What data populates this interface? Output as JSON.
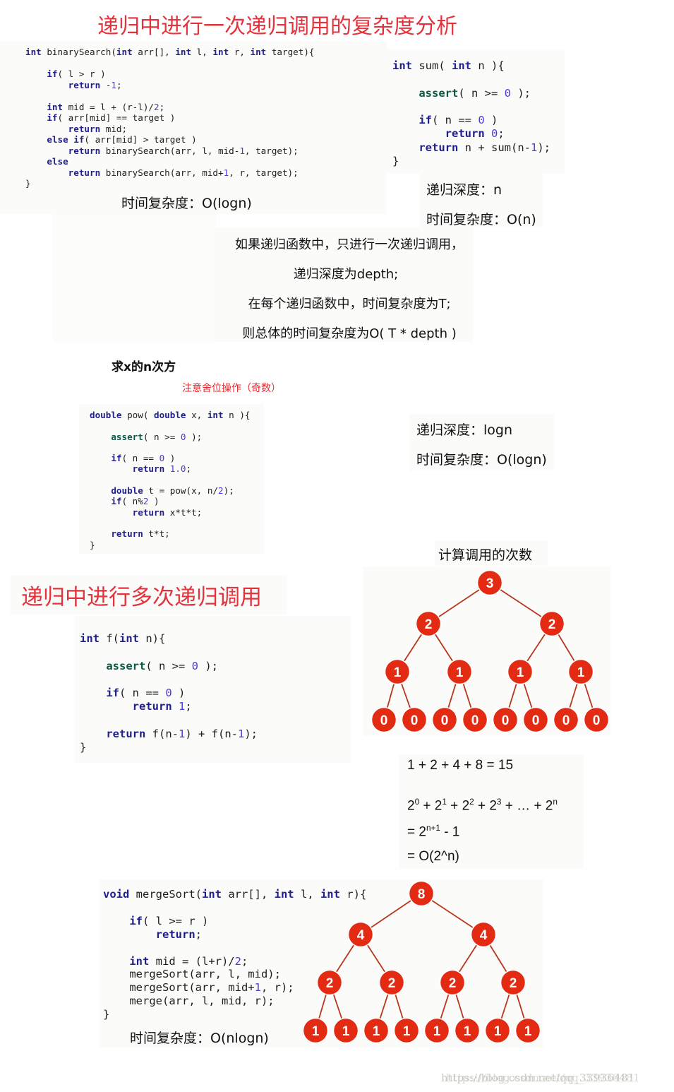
{
  "section1": {
    "title": "递归中进行一次递归调用的复杂度分析",
    "binary_search": {
      "code": [
        [
          [
            "kw",
            "int"
          ],
          [
            "p",
            " binarySearch("
          ],
          [
            "kw",
            "int"
          ],
          [
            "p",
            " arr[], "
          ],
          [
            "kw",
            "int"
          ],
          [
            "p",
            " l, "
          ],
          [
            "kw",
            "int"
          ],
          [
            "p",
            " r, "
          ],
          [
            "kw",
            "int"
          ],
          [
            "p",
            " target){"
          ]
        ],
        [],
        [
          [
            "p",
            "    "
          ],
          [
            "kw",
            "if"
          ],
          [
            "p",
            "( l > r )"
          ]
        ],
        [
          [
            "p",
            "        "
          ],
          [
            "kw",
            "return"
          ],
          [
            "p",
            " -"
          ],
          [
            "num",
            "1"
          ],
          [
            "p",
            ";"
          ]
        ],
        [],
        [
          [
            "p",
            "    "
          ],
          [
            "kw",
            "int"
          ],
          [
            "p",
            " mid = l + (r-l)/"
          ],
          [
            "num",
            "2"
          ],
          [
            "p",
            ";"
          ]
        ],
        [
          [
            "p",
            "    "
          ],
          [
            "kw",
            "if"
          ],
          [
            "p",
            "( arr[mid] == target )"
          ]
        ],
        [
          [
            "p",
            "        "
          ],
          [
            "kw",
            "return"
          ],
          [
            "p",
            " mid;"
          ]
        ],
        [
          [
            "p",
            "    "
          ],
          [
            "kw",
            "else if"
          ],
          [
            "p",
            "( arr[mid] > target )"
          ]
        ],
        [
          [
            "p",
            "        "
          ],
          [
            "kw",
            "return"
          ],
          [
            "p",
            " binarySearch(arr, l, mid-"
          ],
          [
            "num",
            "1"
          ],
          [
            "p",
            ", target);"
          ]
        ],
        [
          [
            "p",
            "    "
          ],
          [
            "kw",
            "else"
          ]
        ],
        [
          [
            "p",
            "        "
          ],
          [
            "kw",
            "return"
          ],
          [
            "p",
            " binarySearch(arr, mid+"
          ],
          [
            "num",
            "1"
          ],
          [
            "p",
            ", r, target);"
          ]
        ],
        [
          [
            "p",
            "}"
          ]
        ]
      ],
      "complexity": "时间复杂度：O(logn)"
    },
    "sum": {
      "code": [
        [
          [
            "kw",
            "int"
          ],
          [
            "p",
            " sum( "
          ],
          [
            "kw",
            "int"
          ],
          [
            "p",
            " n ){"
          ]
        ],
        [],
        [
          [
            "p",
            "    "
          ],
          [
            "as",
            "assert"
          ],
          [
            "p",
            "( n >= "
          ],
          [
            "num",
            "0"
          ],
          [
            "p",
            " );"
          ]
        ],
        [],
        [
          [
            "p",
            "    "
          ],
          [
            "kw",
            "if"
          ],
          [
            "p",
            "( n == "
          ],
          [
            "num",
            "0"
          ],
          [
            "p",
            " )"
          ]
        ],
        [
          [
            "p",
            "        "
          ],
          [
            "kw",
            "return"
          ],
          [
            "p",
            " "
          ],
          [
            "num",
            "0"
          ],
          [
            "p",
            ";"
          ]
        ],
        [
          [
            "p",
            "    "
          ],
          [
            "kw",
            "return"
          ],
          [
            "p",
            " n + sum(n-"
          ],
          [
            "num",
            "1"
          ],
          [
            "p",
            ");"
          ]
        ],
        [
          [
            "p",
            "}"
          ]
        ]
      ],
      "depth": "递归深度：n",
      "complexity": "时间复杂度：O(n)"
    },
    "summary": [
      "如果递归函数中，只进行一次递归调用，",
      "递归深度为depth;",
      "在每个递归函数中，时间复杂度为T;",
      "则总体的时间复杂度为O( T * depth )"
    ]
  },
  "pow_section": {
    "heading": "求x的n次方",
    "note": "注意舍位操作（奇数）",
    "code": [
      [
        [
          "kw",
          "double"
        ],
        [
          "p",
          " pow( "
        ],
        [
          "kw",
          "double"
        ],
        [
          "p",
          " x, "
        ],
        [
          "kw",
          "int"
        ],
        [
          "p",
          " n ){"
        ]
      ],
      [],
      [
        [
          "p",
          "    "
        ],
        [
          "as",
          "assert"
        ],
        [
          "p",
          "( n >= "
        ],
        [
          "num",
          "0"
        ],
        [
          "p",
          " );"
        ]
      ],
      [],
      [
        [
          "p",
          "    "
        ],
        [
          "kw",
          "if"
        ],
        [
          "p",
          "( n == "
        ],
        [
          "num",
          "0"
        ],
        [
          "p",
          " )"
        ]
      ],
      [
        [
          "p",
          "        "
        ],
        [
          "kw",
          "return"
        ],
        [
          "p",
          " "
        ],
        [
          "num",
          "1.0"
        ],
        [
          "p",
          ";"
        ]
      ],
      [],
      [
        [
          "p",
          "    "
        ],
        [
          "kw",
          "double"
        ],
        [
          "p",
          " t = pow(x, n/"
        ],
        [
          "num",
          "2"
        ],
        [
          "p",
          ");"
        ]
      ],
      [
        [
          "p",
          "    "
        ],
        [
          "kw",
          "if"
        ],
        [
          "p",
          "( n%"
        ],
        [
          "num",
          "2"
        ],
        [
          "p",
          " )"
        ]
      ],
      [
        [
          "p",
          "        "
        ],
        [
          "kw",
          "return"
        ],
        [
          "p",
          " x*t*t;"
        ]
      ],
      [],
      [
        [
          "p",
          "    "
        ],
        [
          "kw",
          "return"
        ],
        [
          "p",
          " t*t;"
        ]
      ],
      [
        [
          "p",
          "}"
        ]
      ]
    ],
    "depth": "递归深度：logn",
    "complexity": "时间复杂度：O(logn)"
  },
  "section2": {
    "title": "递归中进行多次递归调用",
    "f_code": [
      [
        [
          "kw",
          "int"
        ],
        [
          "p",
          " f("
        ],
        [
          "kw",
          "int"
        ],
        [
          "p",
          " n){"
        ]
      ],
      [],
      [
        [
          "p",
          "    "
        ],
        [
          "as",
          "assert"
        ],
        [
          "p",
          "( n >= "
        ],
        [
          "num",
          "0"
        ],
        [
          "p",
          " );"
        ]
      ],
      [],
      [
        [
          "p",
          "    "
        ],
        [
          "kw",
          "if"
        ],
        [
          "p",
          "( n == "
        ],
        [
          "num",
          "0"
        ],
        [
          "p",
          " )"
        ]
      ],
      [
        [
          "p",
          "        "
        ],
        [
          "kw",
          "return"
        ],
        [
          "p",
          " "
        ],
        [
          "num",
          "1"
        ],
        [
          "p",
          ";"
        ]
      ],
      [],
      [
        [
          "p",
          "    "
        ],
        [
          "kw",
          "return"
        ],
        [
          "p",
          " f(n-"
        ],
        [
          "num",
          "1"
        ],
        [
          "p",
          ") + f(n-"
        ],
        [
          "num",
          "1"
        ],
        [
          "p",
          ");"
        ]
      ],
      [
        [
          "p",
          "}"
        ]
      ]
    ],
    "call_tree_title": "计算调用的次数",
    "call_tree_levels": [
      [
        "3"
      ],
      [
        "2",
        "2"
      ],
      [
        "1",
        "1",
        "1",
        "1"
      ],
      [
        "0",
        "0",
        "0",
        "0",
        "0",
        "0",
        "0",
        "0"
      ]
    ],
    "sum_line": "1 + 2 + 4 + 8 = 15",
    "series": {
      "base": "2",
      "terms": [
        "0",
        "1",
        "2",
        "3"
      ],
      "ellipsis": "+ … +",
      "last": "n"
    },
    "equals1": {
      "prefix": "= 2",
      "exp": "n+1",
      "suffix": " - 1"
    },
    "equals2": "= O(2^n)"
  },
  "merge_section": {
    "code": [
      [
        [
          "kw",
          "void"
        ],
        [
          "p",
          " mergeSort("
        ],
        [
          "kw",
          "int"
        ],
        [
          "p",
          " arr[], "
        ],
        [
          "kw",
          "int"
        ],
        [
          "p",
          " l, "
        ],
        [
          "kw",
          "int"
        ],
        [
          "p",
          " r){"
        ]
      ],
      [],
      [
        [
          "p",
          "    "
        ],
        [
          "kw",
          "if"
        ],
        [
          "p",
          "( l >= r )"
        ]
      ],
      [
        [
          "p",
          "        "
        ],
        [
          "kw",
          "return"
        ],
        [
          "p",
          ";"
        ]
      ],
      [],
      [
        [
          "p",
          "    "
        ],
        [
          "kw",
          "int"
        ],
        [
          "p",
          " mid = (l+r)/"
        ],
        [
          "num",
          "2"
        ],
        [
          "p",
          ";"
        ]
      ],
      [
        [
          "p",
          "    mergeSort(arr, l, mid);"
        ]
      ],
      [
        [
          "p",
          "    mergeSort(arr, mid+"
        ],
        [
          "num",
          "1"
        ],
        [
          "p",
          ", r);"
        ]
      ],
      [
        [
          "p",
          "    merge(arr, l, mid, r);"
        ]
      ],
      [
        [
          "p",
          "}"
        ]
      ]
    ],
    "complexity": "时间复杂度：O(nlogn)",
    "tree_levels": [
      [
        "8"
      ],
      [
        "4",
        "4"
      ],
      [
        "2",
        "2",
        "2",
        "2"
      ],
      [
        "1",
        "1",
        "1",
        "1",
        "1",
        "1",
        "1",
        "1"
      ]
    ]
  },
  "colors": {
    "title_red": "#e3343d",
    "node_red": "#e32b14",
    "edge": "#b8361c",
    "keyword": "#1f1f8e",
    "assert": "#0b5a45",
    "number": "#4a3ad8"
  },
  "watermark": "https://blog.csdn.net/qq_33936481"
}
